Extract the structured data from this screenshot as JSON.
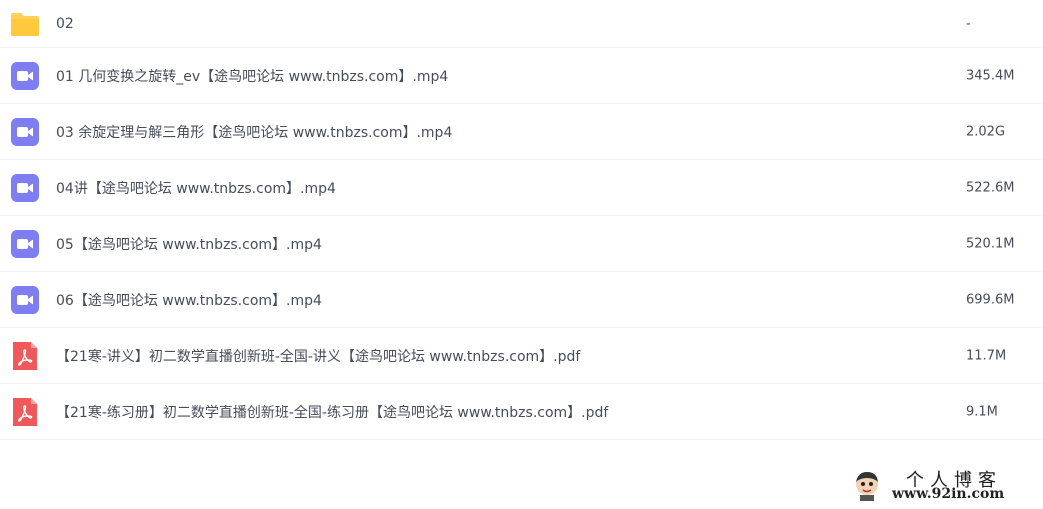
{
  "files": [
    {
      "type": "folder",
      "icon": "folder-icon",
      "name": "02",
      "size": "-"
    },
    {
      "type": "video",
      "icon": "video-icon",
      "name": "01 几何变换之旋转_ev【途鸟吧论坛 www.tnbzs.com】.mp4",
      "size": "345.4M"
    },
    {
      "type": "video",
      "icon": "video-icon",
      "name": "03 余旋定理与解三角形【途鸟吧论坛 www.tnbzs.com】.mp4",
      "size": "2.02G"
    },
    {
      "type": "video",
      "icon": "video-icon",
      "name": "04讲【途鸟吧论坛 www.tnbzs.com】.mp4",
      "size": "522.6M"
    },
    {
      "type": "video",
      "icon": "video-icon",
      "name": "05【途鸟吧论坛 www.tnbzs.com】.mp4",
      "size": "520.1M"
    },
    {
      "type": "video",
      "icon": "video-icon",
      "name": "06【途鸟吧论坛 www.tnbzs.com】.mp4",
      "size": "699.6M"
    },
    {
      "type": "pdf",
      "icon": "pdf-icon",
      "name": "【21寒-讲义】初二数学直播创新班-全国-讲义【途鸟吧论坛 www.tnbzs.com】.pdf",
      "size": "11.7M"
    },
    {
      "type": "pdf",
      "icon": "pdf-icon",
      "name": "【21寒-练习册】初二数学直播创新班-全国-练习册【途鸟吧论坛 www.tnbzs.com】.pdf",
      "size": "9.1M"
    }
  ],
  "colors": {
    "folder": "#ffd15c",
    "video": "#7e7ef0",
    "pdf": "#f0595b"
  },
  "watermark": {
    "title": "个人博客",
    "url": "www.92in.com"
  }
}
